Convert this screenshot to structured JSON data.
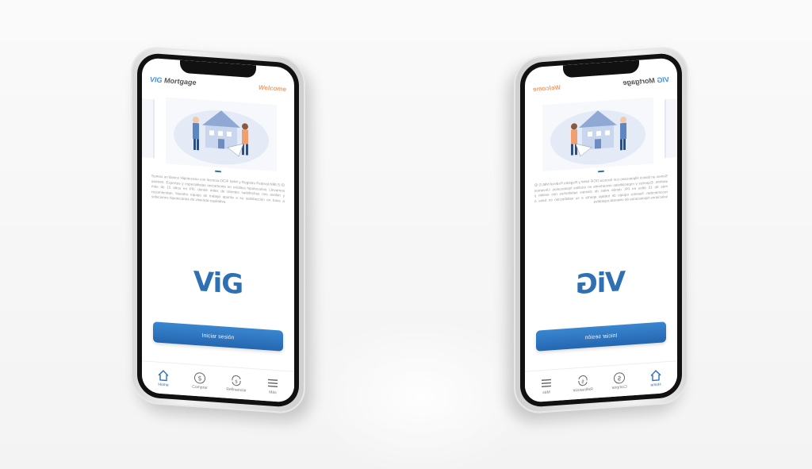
{
  "app": {
    "brand_prefix": "VIG",
    "brand_suffix": "Mortgage",
    "welcome": "Welcome"
  },
  "about_text": "Somos un Banco Hipotecario con licencia OCIF #### y Registro Federal NMLS ID ######. Expertos y especialistas únicamente en créditos hipotecarios. Llevamos más de 15 años en PR, donde miles de clientes satisfechos nos avalan y recomiendan. Nuestro equipo de trabajo apunta a su satisfacción en base a soluciones hipotecarias de vivienda equitativa.",
  "logo_text": "ViG",
  "login_label": "Iniciar sesión",
  "tabs": [
    {
      "label": "Home",
      "icon": "home-icon"
    },
    {
      "label": "Comprar",
      "icon": "dollar-icon"
    },
    {
      "label": "Refinanciar",
      "icon": "refinance-icon"
    },
    {
      "label": "Más",
      "icon": "menu-icon"
    }
  ],
  "colors": {
    "brand_blue": "#2f6fb3",
    "accent_orange": "#f0a070",
    "button": "#2a6fb5"
  }
}
